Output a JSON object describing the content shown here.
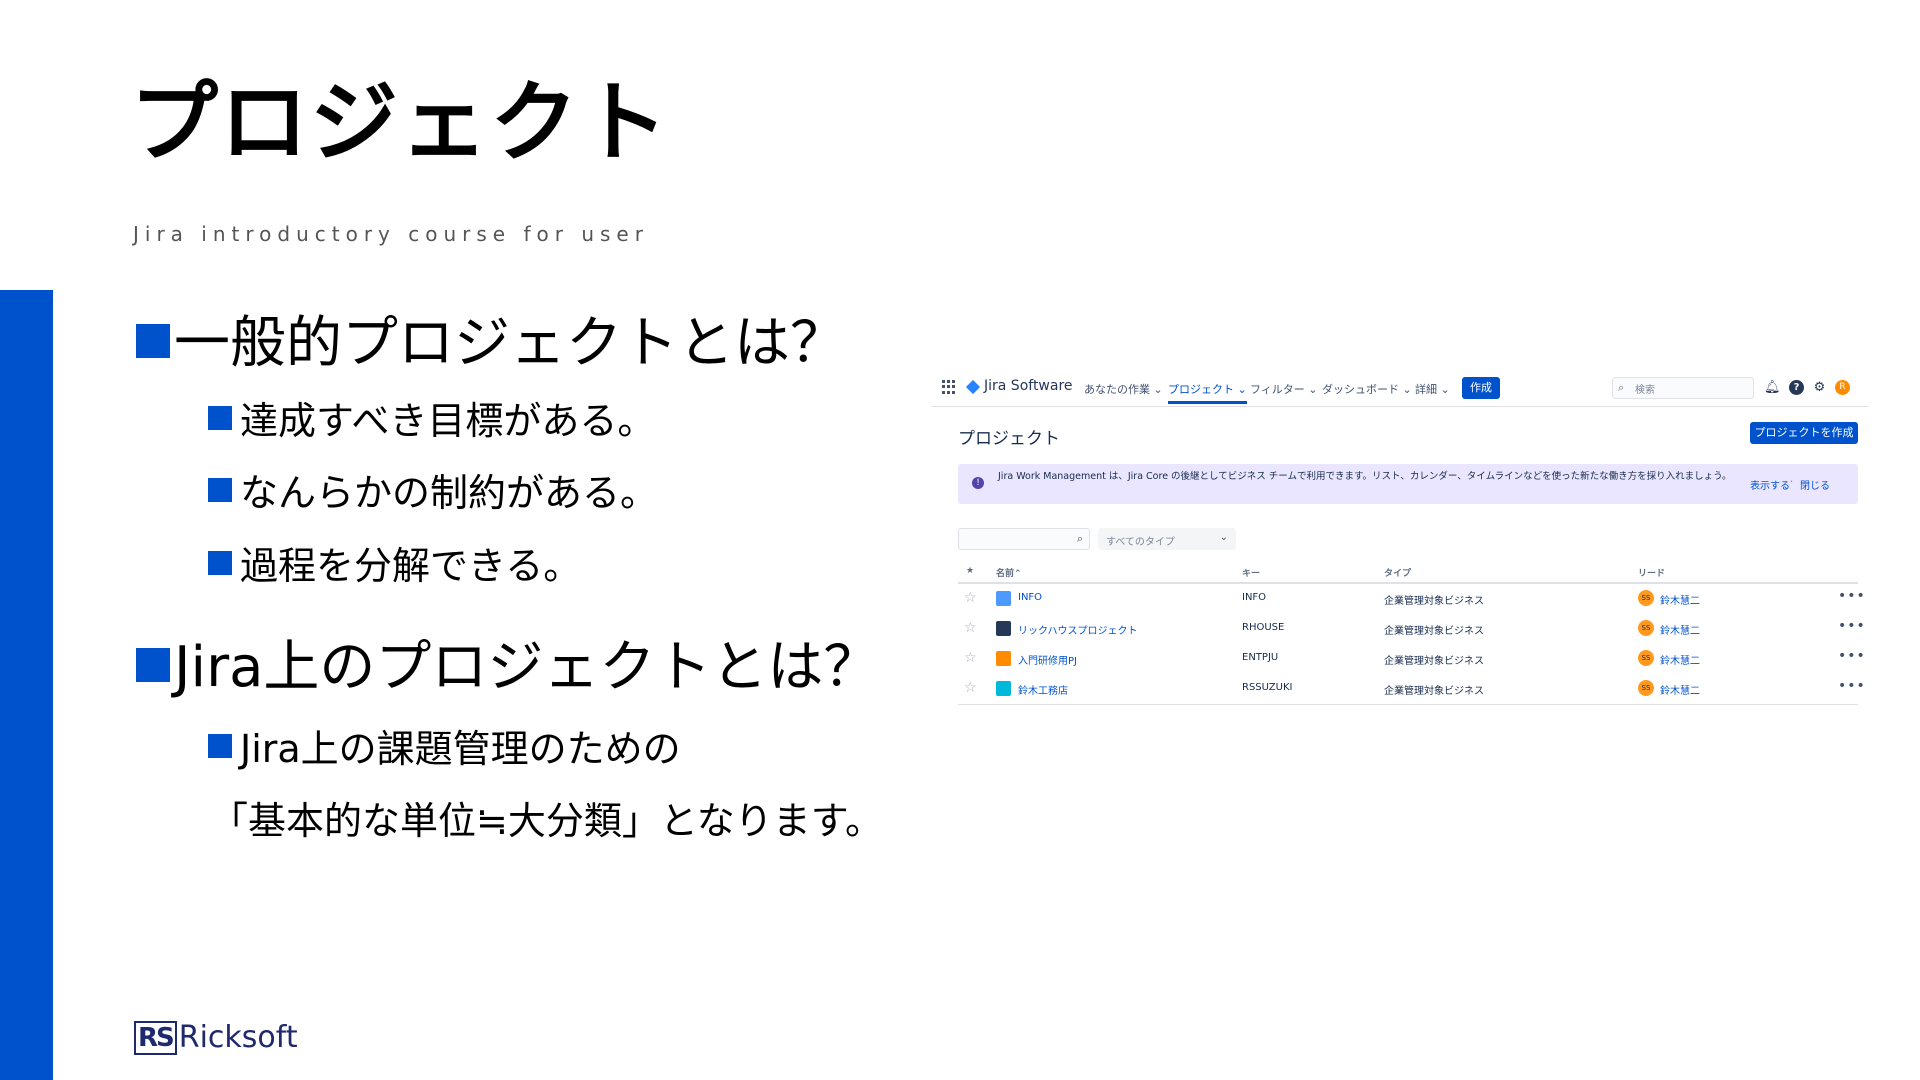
{
  "slide": {
    "title": "プロジェクト",
    "subtitle": "Jira introductory course for user",
    "bullets": {
      "b1": "一般的プロジェクトとは？",
      "b1_1": "達成すべき目標がある。",
      "b1_2": "なんらかの制約がある。",
      "b1_3": "過程を分解できる。",
      "b2": "Jira上のプロジェクトとは？",
      "b2_1": "Jira上の課題管理のための",
      "b2_1_cont": "「基本的な単位≒大分類」となります。"
    }
  },
  "jira": {
    "brand": "Jira Software",
    "nav": [
      "あなたの作業",
      "プロジェクト",
      "フィルター",
      "ダッシュボード",
      "詳細"
    ],
    "create_label": "作成",
    "search_placeholder": "検索",
    "avatar_initial": "R",
    "page_title": "プロジェクト",
    "create_project_label": "プロジェクトを作成",
    "banner_text": "Jira Work Management は、Jira Core の後継としてビジネス チームで利用できます。リスト、カレンダー、タイムラインなどを使った新たな働き方を採り入れましょう。",
    "banner_show": "表示する",
    "banner_close": "閉じる",
    "type_filter": "すべてのタイプ",
    "columns": [
      "名前",
      "キー",
      "タイプ",
      "リード"
    ],
    "rows": [
      {
        "name": "INFO",
        "key": "INFO",
        "type": "企業管理対象ビジネス",
        "lead_initials": "SS",
        "lead": "鈴木慧二",
        "icon_color": "#4c9aff"
      },
      {
        "name": "リックハウスプロジェクト",
        "key": "RHOUSE",
        "type": "企業管理対象ビジネス",
        "lead_initials": "SS",
        "lead": "鈴木慧二",
        "icon_color": "#253858"
      },
      {
        "name": "入門研修用PJ",
        "key": "ENTPJU",
        "type": "企業管理対象ビジネス",
        "lead_initials": "SS",
        "lead": "鈴木慧二",
        "icon_color": "#ff8b00"
      },
      {
        "name": "鈴木工務店",
        "key": "RSSUZUKI",
        "type": "企業管理対象ビジネス",
        "lead_initials": "SS",
        "lead": "鈴木慧二",
        "icon_color": "#00b8d9"
      }
    ]
  },
  "footer": {
    "logo_mark": "RS",
    "logo_text": "Ricksoft"
  }
}
